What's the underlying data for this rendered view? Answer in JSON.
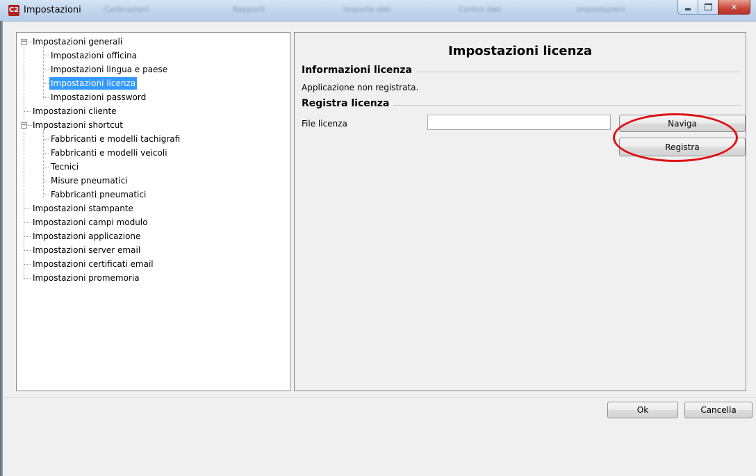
{
  "window": {
    "title": "Impostazioni",
    "icon_glyph": "C2",
    "background_tabs": [
      "Calibrazioni",
      "Rapporti",
      "Importa dati",
      "Centro dati",
      "Impostazioni"
    ]
  },
  "tree": {
    "items": [
      {
        "label": "Impostazioni generali",
        "expander": "−"
      },
      {
        "label": "Impostazioni officina"
      },
      {
        "label": "Impostazioni lingua e paese"
      },
      {
        "label": "Impostazioni licenza",
        "selected": true
      },
      {
        "label": "Impostazioni password"
      },
      {
        "label": "Impostazioni cliente"
      },
      {
        "label": "Impostazioni shortcut",
        "expander": "−"
      },
      {
        "label": "Fabbricanti e modelli tachigrafi"
      },
      {
        "label": "Fabbricanti e modelli veicoli"
      },
      {
        "label": "Tecnici"
      },
      {
        "label": "Misure pneumatici"
      },
      {
        "label": "Fabbricanti pneumatici"
      },
      {
        "label": "Impostazioni stampante"
      },
      {
        "label": "Impostazioni campi modulo"
      },
      {
        "label": "Impostazioni applicazione"
      },
      {
        "label": "Impostazioni server email"
      },
      {
        "label": "Impostazioni certificati email"
      },
      {
        "label": "Impostazioni promemoria"
      }
    ]
  },
  "content": {
    "title": "Impostazioni licenza",
    "info_section": {
      "label": "Informazioni licenza",
      "status_text": "Applicazione non registrata."
    },
    "register_section": {
      "label": "Registra licenza",
      "file_label": "File licenza",
      "file_value": "",
      "browse_label": "Naviga",
      "register_label": "Registra"
    }
  },
  "footer": {
    "ok_label": "Ok",
    "cancel_label": "Cancella"
  },
  "colors": {
    "selection": "#3399ff",
    "highlight_ellipse": "#e01010"
  }
}
